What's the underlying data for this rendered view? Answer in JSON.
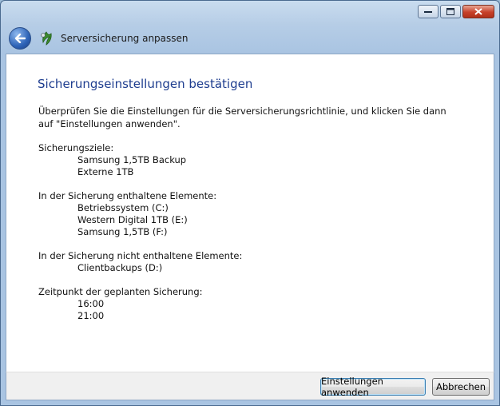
{
  "window": {
    "title": "Serversicherung anpassen"
  },
  "page": {
    "heading": "Sicherungseinstellungen bestätigen",
    "intro": "Überprüfen Sie die Einstellungen für die Serversicherungsrichtlinie, und klicken Sie dann auf \"Einstellungen anwenden\".",
    "targets_label": "Sicherungsziele:",
    "targets": [
      "Samsung 1,5TB Backup",
      "Externe 1TB"
    ],
    "included_label": "In der Sicherung enthaltene Elemente:",
    "included": [
      "Betriebssystem (C:)",
      "Western Digital 1TB (E:)",
      "Samsung 1,5TB (F:)"
    ],
    "excluded_label": "In der Sicherung nicht enthaltene Elemente:",
    "excluded": [
      "Clientbackups (D:)"
    ],
    "schedule_label": "Zeitpunkt der geplanten Sicherung:",
    "schedule": [
      "16:00",
      "21:00"
    ]
  },
  "buttons": {
    "apply": "Einstellungen anwenden",
    "cancel": "Abbrechen"
  },
  "icons": {
    "back": "back-arrow-icon",
    "wizard": "server-backup-icon",
    "minimize": "minimize-icon",
    "maximize": "maximize-icon",
    "close": "close-icon"
  }
}
